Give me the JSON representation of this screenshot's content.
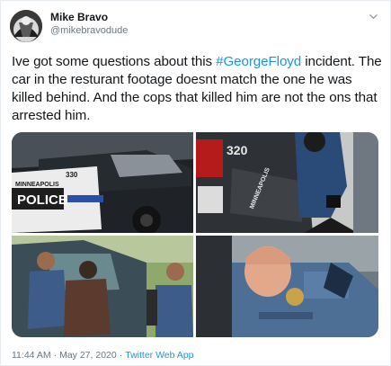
{
  "user": {
    "display_name": "Mike Bravo",
    "handle": "@mikebravodude"
  },
  "tweet": {
    "text_part1": "Ive got some questions about this ",
    "hashtag": "#GeorgeFloyd",
    "text_part2": " incident. The car in the resturant footage doesnt match the one he was killed behind. And the cops that killed him are not the ons that arrested him."
  },
  "media": {
    "car_door_text_1": "MINNEAPOLIS",
    "car_door_text_2": "POLICE",
    "car_number_1": "330",
    "car_number_2": "320",
    "car_side_text": "MINNEAPOLIS"
  },
  "footer": {
    "time": "11:44 AM",
    "separator": "·",
    "date": "May 27, 2020",
    "source": "Twitter Web App"
  },
  "icons": {
    "menu": "chevron-down-icon"
  }
}
